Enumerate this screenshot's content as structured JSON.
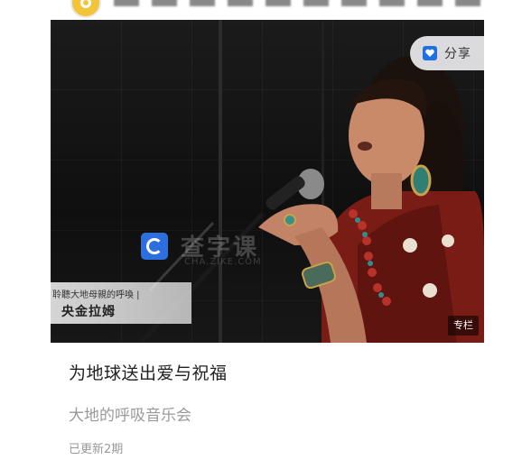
{
  "header": {
    "logo_icon": "channel-logo-icon"
  },
  "video": {
    "share_label": "分享",
    "share_icon": "share-icon",
    "watermark_text": "查字课",
    "watermark_sub": "CHA.ZIKE.COM",
    "caption_subtitle": "聆聽大地母親的呼喚 |",
    "caption_name": "央金拉姆",
    "badge": "专栏"
  },
  "content": {
    "title": "为地球送出爱与祝福",
    "subtitle": "大地的呼吸音乐会",
    "updated": "已更新2期"
  },
  "colors": {
    "share_accent": "#1f6fe5",
    "watermark_icon": "#2e6fe0",
    "title": "#222222",
    "muted": "#999999"
  }
}
